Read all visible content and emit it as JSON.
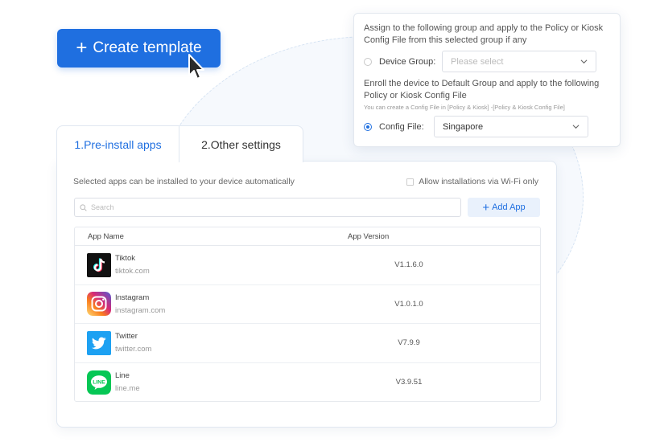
{
  "create_button": {
    "label": "Create template"
  },
  "popup": {
    "assign_text": "Assign to the following group and apply to the Policy or Kiosk Config File from this selected group if any",
    "device_group_label": "Device Group:",
    "device_group_placeholder": "Please select",
    "enroll_text": "Enroll the device to Default Group and apply to the following Policy or Kiosk Config File",
    "hint": "You can create a Config File in [Policy & Kiosk] -[Policy & Kiosk Config File]",
    "config_file_label": "Config File:",
    "config_file_value": "Singapore",
    "selected_option": "config-file"
  },
  "tabs": [
    {
      "label": "1.Pre-install apps",
      "active": true
    },
    {
      "label": "2.Other settings",
      "active": false
    }
  ],
  "main": {
    "description": "Selected apps can be installed to your device automatically",
    "wifi_label": "Allow installations via Wi-Fi only",
    "wifi_checked": false,
    "search_placeholder": "Search",
    "add_app_label": "Add App"
  },
  "table": {
    "columns": [
      "App Name",
      "App Version"
    ],
    "rows": [
      {
        "name": "Tiktok",
        "domain": "tiktok.com",
        "version": "V1.1.6.0",
        "icon": "tiktok-icon"
      },
      {
        "name": "Instagram",
        "domain": "instagram.com",
        "version": "V1.0.1.0",
        "icon": "instagram-icon"
      },
      {
        "name": "Twitter",
        "domain": "twitter.com",
        "version": "V7.9.9",
        "icon": "twitter-icon"
      },
      {
        "name": "Line",
        "domain": "line.me",
        "version": "V3.9.51",
        "icon": "line-icon"
      }
    ]
  },
  "colors": {
    "primary": "#1f6fe0",
    "tab_active": "#1f6fe0",
    "add_app_bg": "#e9f1fc"
  }
}
